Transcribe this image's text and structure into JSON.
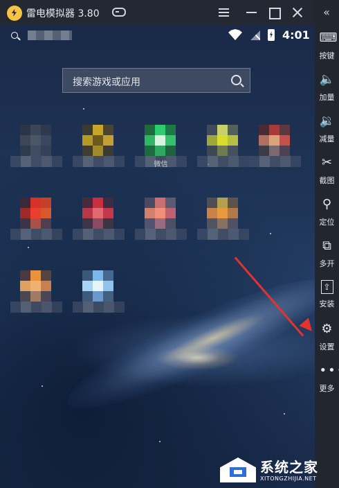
{
  "titlebar": {
    "app_name": "雷电模拟器",
    "version": "3.80",
    "icons": [
      "lightning-logo-icon",
      "gamepad-icon",
      "menu-icon",
      "minimize-icon",
      "maximize-icon",
      "close-icon"
    ]
  },
  "statusbar": {
    "time": "4:01",
    "icons": [
      "search-icon",
      "wifi-icon",
      "no-signal-icon",
      "battery-charging-icon"
    ]
  },
  "search": {
    "placeholder": "搜索游戏或应用"
  },
  "apps": [
    {
      "label": "",
      "colors": [
        "#2a3548",
        "#3a4558",
        "#2c3a50",
        "#3c4656",
        "#4a5668",
        "#3a4760",
        "#2e3a4e",
        "#404c62",
        "#344258"
      ]
    },
    {
      "label": "",
      "colors": [
        "#3a3a32",
        "#c8a42a",
        "#4a4430",
        "#b49a22",
        "#6a5a1c",
        "#c4a030",
        "#403c30",
        "#a08a2a",
        "#3c3a34"
      ]
    },
    {
      "label": "微信",
      "colors": [
        "#1f6a3c",
        "#2ecc71",
        "#1e7a44",
        "#2fb566",
        "#d8f4e0",
        "#33c16c",
        "#1d6a3e",
        "#2ea860",
        "#1e6240"
      ]
    },
    {
      "label": "",
      "colors": [
        "#3f4a5a",
        "#c7d06a",
        "#54605a",
        "#9ea83a",
        "#d8dc2c",
        "#b4c040",
        "#3e4852",
        "#6e7a52",
        "#46505e"
      ]
    },
    {
      "label": "",
      "colors": [
        "#4a2a34",
        "#a83a3a",
        "#5a3a40",
        "#b07060",
        "#d8a47c",
        "#c4504c",
        "#3e3a48",
        "#7a6a70",
        "#4c4252"
      ]
    },
    {
      "label": "",
      "colors": [
        "#3a2a38",
        "#d8302a",
        "#c4402a",
        "#a02a28",
        "#e8402c",
        "#d85a2a",
        "#3a3448",
        "#a8504a",
        "#4e3e50"
      ]
    },
    {
      "label": "",
      "colors": [
        "#4a2a3a",
        "#c83040",
        "#3c2e40",
        "#b83848",
        "#e06a70",
        "#c0384a",
        "#3c3448",
        "#8a4a60",
        "#3a3446"
      ]
    },
    {
      "label": "",
      "colors": [
        "#4a4a62",
        "#c87070",
        "#5a5a74",
        "#d0806c",
        "#f0907a",
        "#c06070",
        "#505470",
        "#9a6a80",
        "#4c5066"
      ]
    },
    {
      "label": "",
      "colors": [
        "#4e4e54",
        "#b0a050",
        "#5c5448",
        "#c88448",
        "#e89a40",
        "#b07a48",
        "#505460",
        "#8a7060",
        "#4e5262"
      ]
    },
    {
      "label": "",
      "colors": [
        "#4a3a40",
        "#e8923e",
        "#54463e",
        "#e0a060",
        "#f0b070",
        "#c88050",
        "#4c4650",
        "#a07a64",
        "#4a4656"
      ]
    },
    {
      "label": "",
      "colors": [
        "#3a5878",
        "#7ab8ec",
        "#446890",
        "#a8d4f4",
        "#e8f4fc",
        "#90c4ec",
        "#3c5a7c",
        "#6a9acc",
        "#42607e"
      ]
    }
  ],
  "sidebar": {
    "collapse_icon": "double-chevron-left-icon",
    "items": [
      {
        "label": "按键",
        "icon": "keyboard-icon"
      },
      {
        "label": "加量",
        "icon": "volume-up-icon"
      },
      {
        "label": "减量",
        "icon": "volume-down-icon"
      },
      {
        "label": "截图",
        "icon": "scissors-icon"
      },
      {
        "label": "定位",
        "icon": "location-pin-icon"
      },
      {
        "label": "多开",
        "icon": "multi-instance-icon"
      },
      {
        "label": "安装",
        "icon": "apk-install-icon"
      },
      {
        "label": "设置",
        "icon": "gear-icon"
      },
      {
        "label": "更多",
        "icon": "more-dots-icon"
      }
    ]
  },
  "annotation": {
    "arrow_color": "#e4322f",
    "target": "设置"
  },
  "watermark": {
    "title": "系统之家",
    "subtitle": "XITONGZHIJIA.NET",
    "icon": "house-logo-icon"
  }
}
